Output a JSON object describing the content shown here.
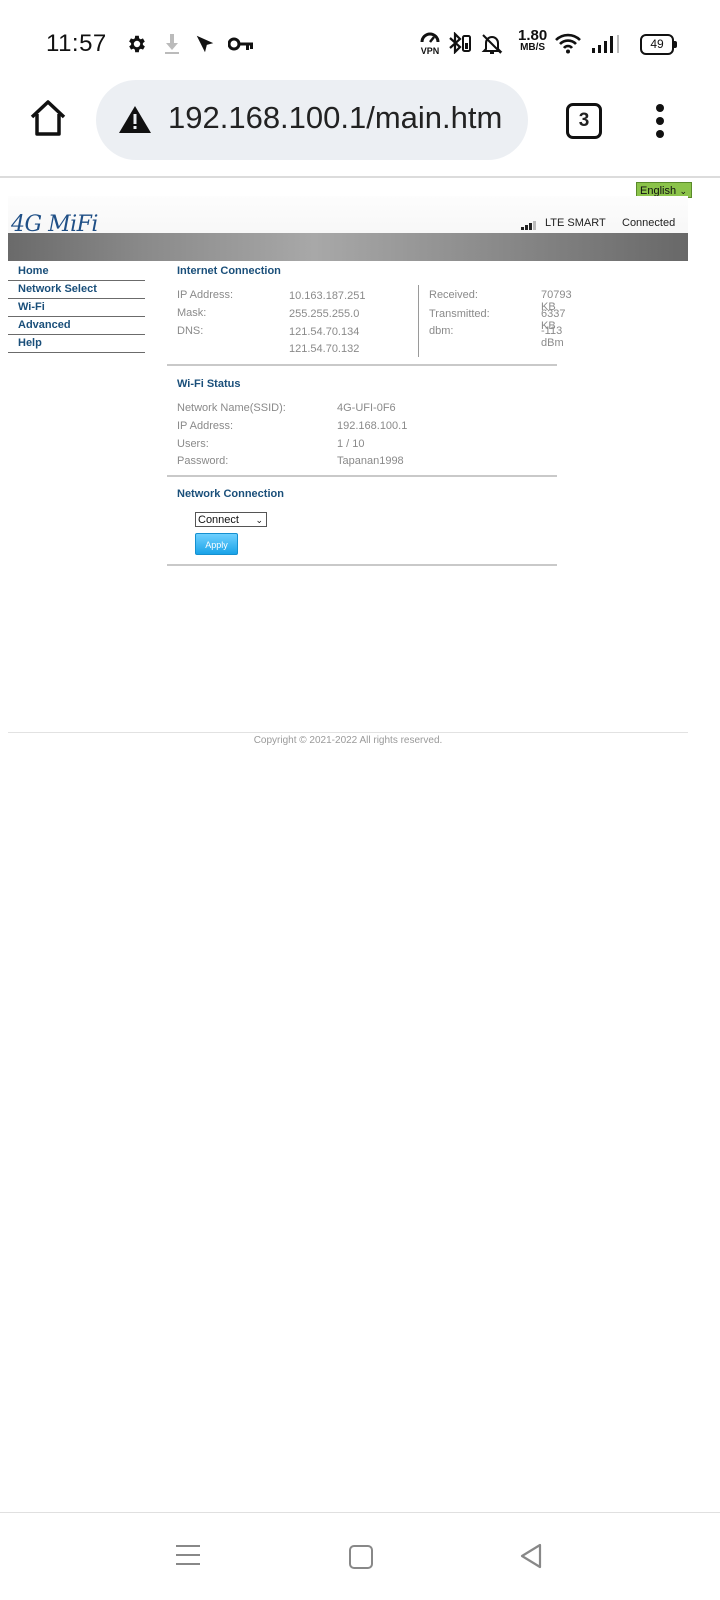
{
  "status_bar": {
    "time": "11:57",
    "speed_value": "1.80",
    "speed_unit": "MB/S",
    "battery": "49",
    "vpn_label": "VPN",
    "icons": [
      "gear-icon",
      "download-icon",
      "send-icon",
      "key-icon",
      "vpn-icon",
      "bluetooth-icon",
      "bell-off-icon",
      "wifi-icon",
      "cell-signal-icon",
      "battery-icon"
    ]
  },
  "browser": {
    "url": "192.168.100.1/main.htm",
    "tab_count": "3"
  },
  "page": {
    "language": "English",
    "logo": "4G MiFi",
    "network_name": "LTE SMART",
    "connection_status": "Connected",
    "nav": [
      "Home",
      "Network Select",
      "Wi-Fi",
      "Advanced",
      "Help"
    ],
    "internet": {
      "title": "Internet Connection",
      "ip_label": "IP Address:",
      "ip_value": "10.163.187.251",
      "mask_label": "Mask:",
      "mask_value": "255.255.255.0",
      "dns_label": "DNS:",
      "dns_value1": "121.54.70.134",
      "dns_value2": "121.54.70.132",
      "received_label": "Received:",
      "received_value": "70793 KB",
      "transmitted_label": "Transmitted:",
      "transmitted_value": "6337 KB",
      "dbm_label": "dbm:",
      "dbm_value": "-113 dBm"
    },
    "wifi": {
      "title": "Wi-Fi Status",
      "ssid_label": "Network Name(SSID):",
      "ssid_value": "4G-UFI-0F6",
      "ip_label": "IP Address:",
      "ip_value": "192.168.100.1",
      "users_label": "Users:",
      "users_value": "1 / 10",
      "password_label": "Password:",
      "password_value": "Tapanan1998"
    },
    "network_connection": {
      "title": "Network Connection",
      "selected": "Connect",
      "apply_label": "Apply"
    },
    "copyright": "Copyright © 2021-2022 All rights reserved."
  }
}
